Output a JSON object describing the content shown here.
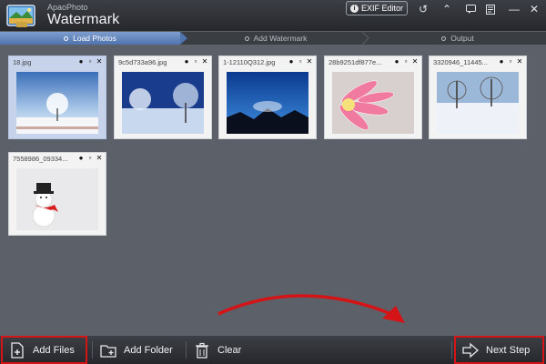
{
  "app": {
    "brand_sub": "ApaoPhoto",
    "brand": "Watermark"
  },
  "toolbar": {
    "exif_label": "EXIF Editor",
    "exif_icon": "exif-icon",
    "icons": [
      "undo-icon",
      "share-icon",
      "chat-icon",
      "document-icon",
      "minimize-icon",
      "close-icon"
    ]
  },
  "steps": [
    {
      "label": "Load Photos",
      "active": true
    },
    {
      "label": "Add Watermark",
      "active": false
    },
    {
      "label": "Output",
      "active": false
    }
  ],
  "photos": [
    {
      "name": "18.jpg"
    },
    {
      "name": "9c5d733a96.jpg"
    },
    {
      "name": "1-12110Q312.jpg"
    },
    {
      "name": "28b9251df877e..."
    },
    {
      "name": "3320946_11445..."
    },
    {
      "name": "7558986_09334..."
    }
  ],
  "bottom": {
    "add_files": "Add Files",
    "add_folder": "Add Folder",
    "clear": "Clear",
    "next_step": "Next Step"
  },
  "colors": {
    "accent": "#5a7cb5",
    "highlight": "#d41416",
    "background": "#5c6068"
  }
}
